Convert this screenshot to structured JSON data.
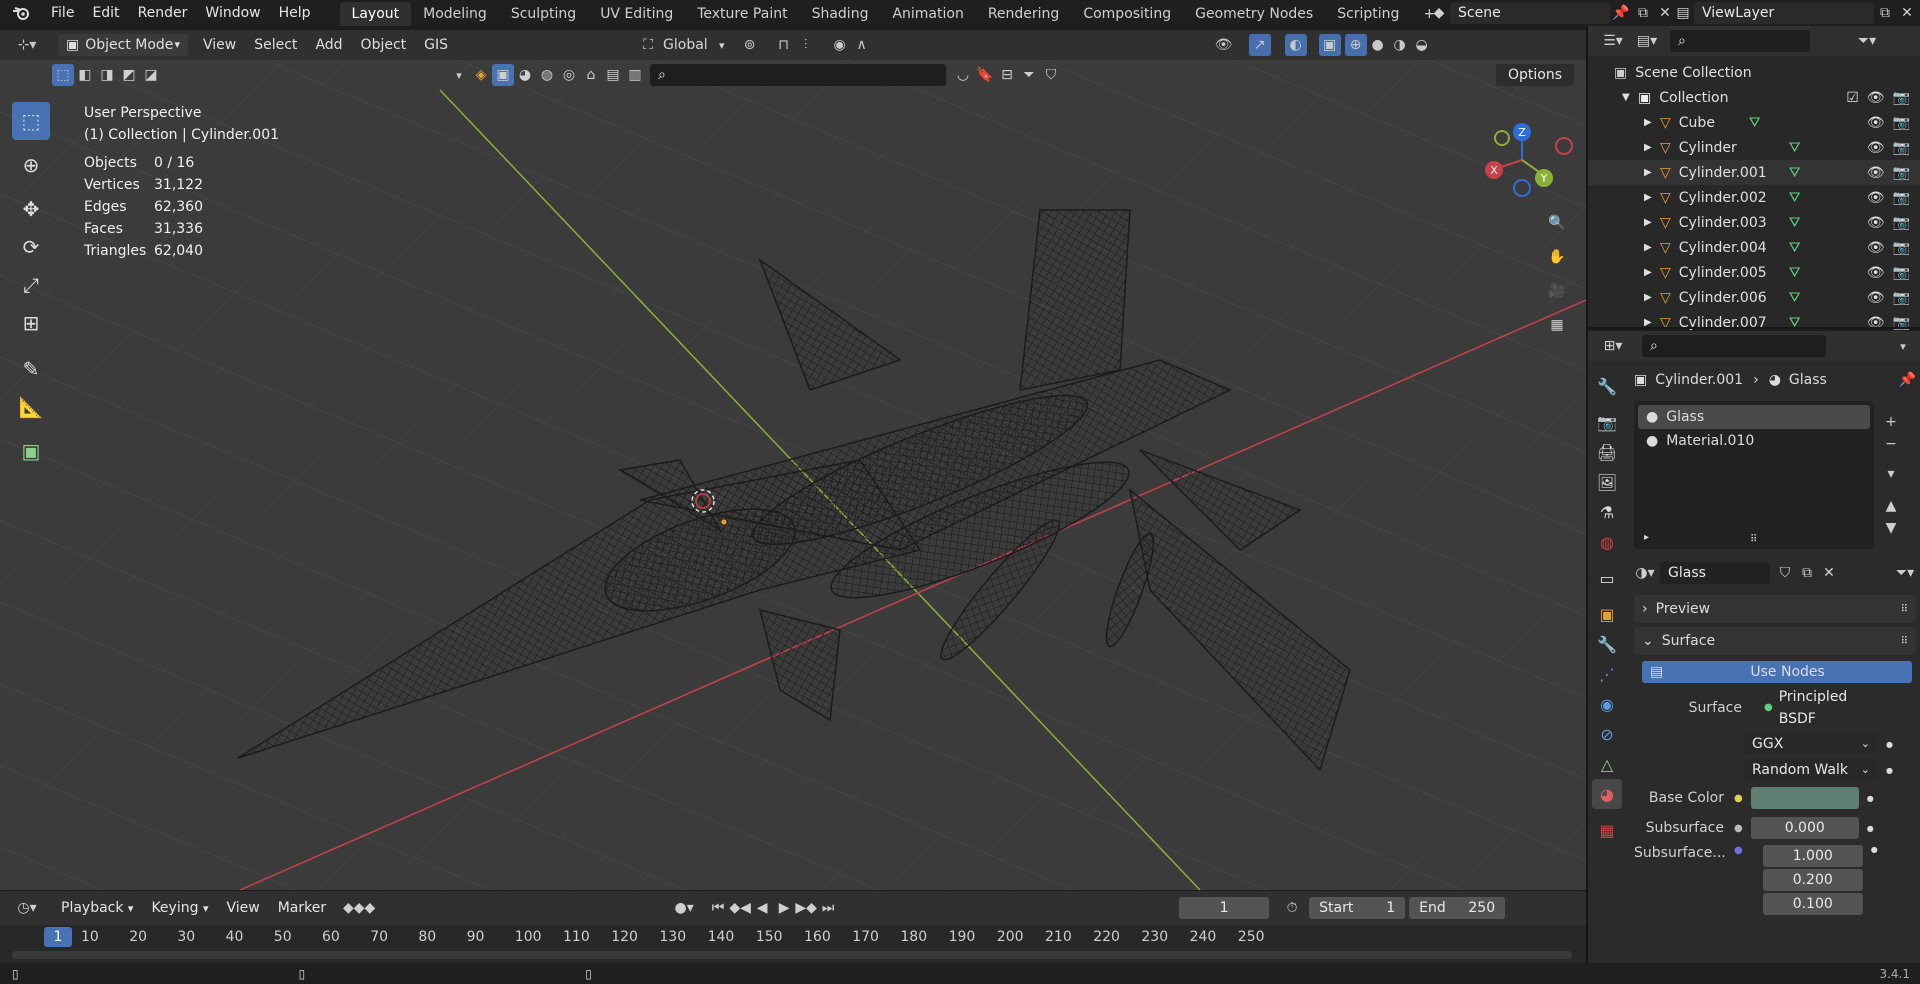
{
  "topbar": {
    "menus": [
      "File",
      "Edit",
      "Render",
      "Window",
      "Help"
    ],
    "workspaces": [
      "Layout",
      "Modeling",
      "Sculpting",
      "UV Editing",
      "Texture Paint",
      "Shading",
      "Animation",
      "Rendering",
      "Compositing",
      "Geometry Nodes",
      "Scripting"
    ],
    "active_workspace": "Layout",
    "add_tab": "+",
    "scene": "Scene",
    "view_layer": "ViewLayer"
  },
  "viewport_header": {
    "mode": "Object Mode",
    "menus": [
      "View",
      "Select",
      "Add",
      "Object",
      "GIS"
    ],
    "orientation": "Global",
    "options": "Options",
    "search_placeholder": ""
  },
  "viewport": {
    "perspective": "User Perspective",
    "collection_info": "(1) Collection | Cylinder.001",
    "stats": [
      {
        "label": "Objects",
        "value": "0 / 16"
      },
      {
        "label": "Vertices",
        "value": "31,122"
      },
      {
        "label": "Edges",
        "value": "62,360"
      },
      {
        "label": "Faces",
        "value": "31,336"
      },
      {
        "label": "Triangles",
        "value": "62,040"
      }
    ],
    "gizmo_axes": {
      "x": "X",
      "y": "Y",
      "z": "Z"
    },
    "colors": {
      "background": "#3b3b3b",
      "x_axis": "#c8404a",
      "y_axis": "#8bb038",
      "z_axis": "#2f6fd6"
    }
  },
  "outliner": {
    "search_placeholder": "",
    "root": "Scene Collection",
    "collection": "Collection",
    "items": [
      "Cube",
      "Cylinder",
      "Cylinder.001",
      "Cylinder.002",
      "Cylinder.003",
      "Cylinder.004",
      "Cylinder.005",
      "Cylinder.006",
      "Cylinder.007"
    ]
  },
  "properties": {
    "breadcrumb_object": "Cylinder.001",
    "breadcrumb_material": "Glass",
    "slots": [
      "Glass",
      "Material.010"
    ],
    "material_name": "Glass",
    "preview_label": "Preview",
    "surface_label": "Surface",
    "use_nodes": "Use Nodes",
    "surface_field_label": "Surface",
    "surface_shader": "Principled BSDF",
    "distribution": "GGX",
    "subsurface_method": "Random Walk",
    "base_color_label": "Base Color",
    "base_color": "#5f7f73",
    "subsurface_label": "Subsurface",
    "subsurface_value": "0.000",
    "subsurface_radius_label": "Subsurface...",
    "subsurface_radius": [
      "1.000",
      "0.200",
      "0.100"
    ]
  },
  "timeline": {
    "menus": [
      "Playback",
      "Keying",
      "View",
      "Marker"
    ],
    "current_frame": "1",
    "start_label": "Start",
    "start_value": "1",
    "end_label": "End",
    "end_value": "250",
    "ticks": [
      "10",
      "20",
      "30",
      "40",
      "50",
      "60",
      "70",
      "80",
      "90",
      "100",
      "110",
      "120",
      "130",
      "140",
      "150",
      "160",
      "170",
      "180",
      "190",
      "200",
      "210",
      "220",
      "230",
      "240",
      "250"
    ],
    "playhead": "1"
  },
  "statusbar": {
    "version": "3.4.1"
  }
}
